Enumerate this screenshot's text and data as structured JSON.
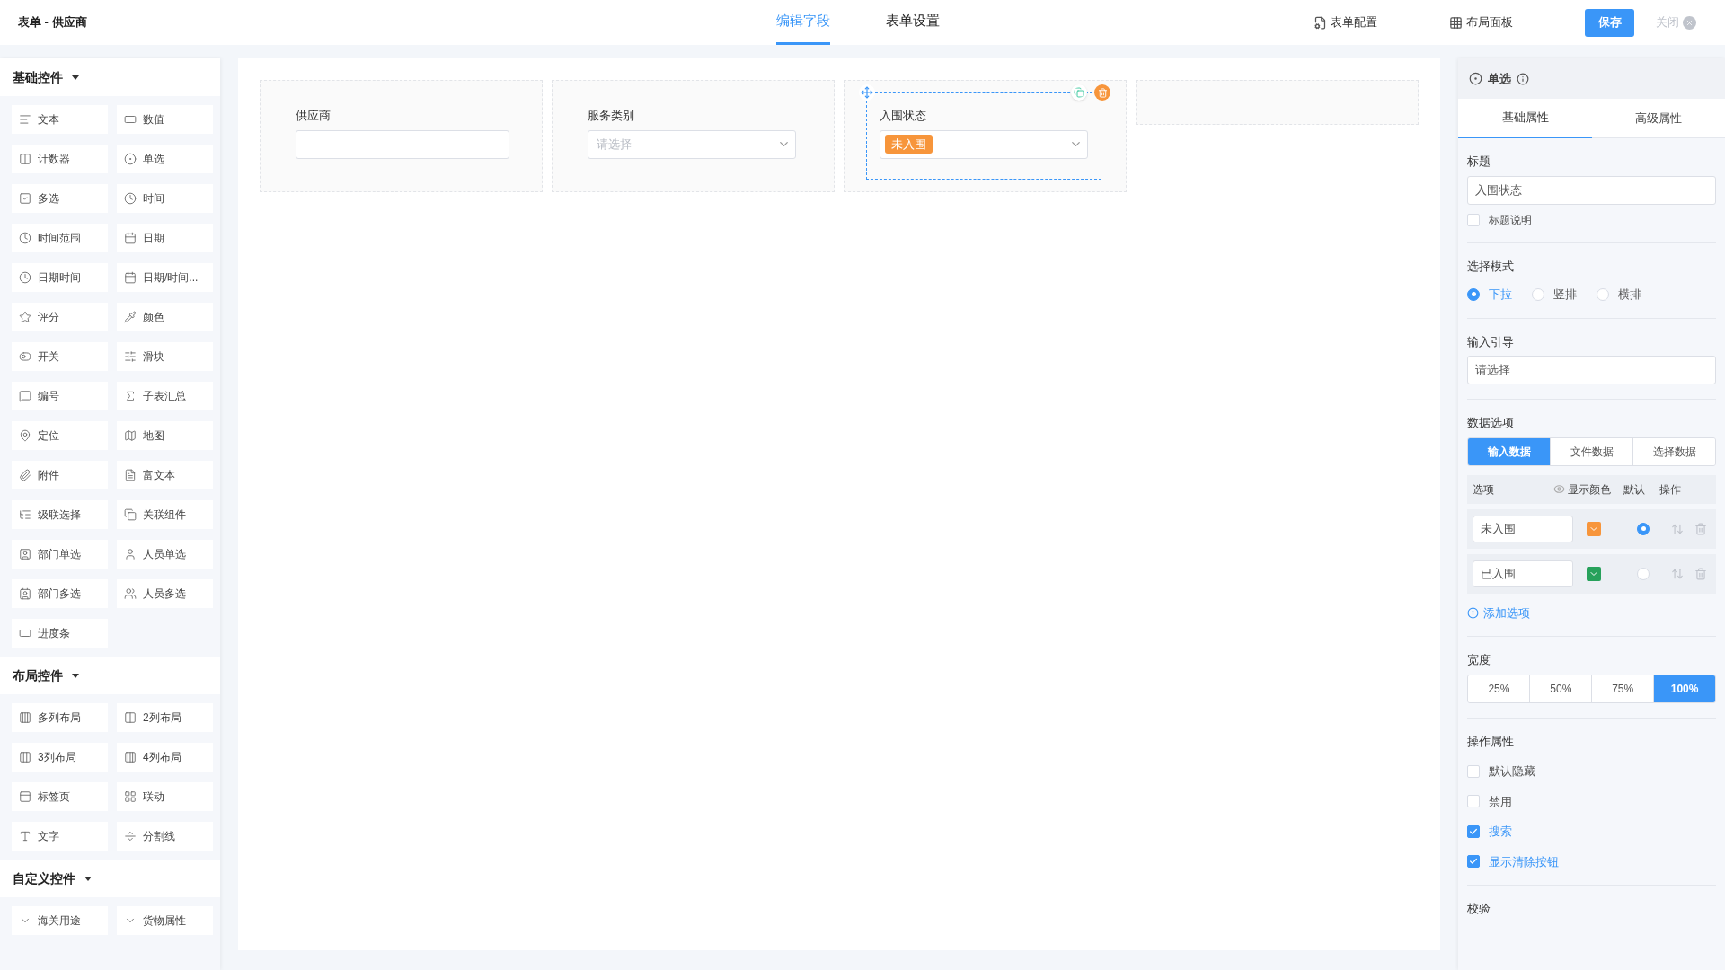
{
  "window": {
    "title": "表单 - 供应商"
  },
  "top_tabs": [
    {
      "label": "编辑字段",
      "selected": true
    },
    {
      "label": "表单设置",
      "selected": false
    }
  ],
  "toolbar": {
    "form_config": "表单配置",
    "layout_panel": "布局面板",
    "save": "保存",
    "close": "关闭"
  },
  "sidebar": {
    "sections": [
      {
        "title": "基础控件",
        "expanded": true,
        "items": [
          "文本",
          "数值",
          "计数器",
          "单选",
          "多选",
          "时间",
          "时间范围",
          "日期",
          "日期时间",
          "日期/时间...",
          "评分",
          "颜色",
          "开关",
          "滑块",
          "编号",
          "子表汇总",
          "定位",
          "地图",
          "附件",
          "富文本",
          "级联选择",
          "关联组件",
          "部门单选",
          "人员单选",
          "部门多选",
          "人员多选",
          "进度条"
        ]
      },
      {
        "title": "布局控件",
        "expanded": true,
        "items": [
          "多列布局",
          "2列布局",
          "3列布局",
          "4列布局",
          "标签页",
          "联动",
          "文字",
          "分割线"
        ]
      },
      {
        "title": "自定义控件",
        "expanded": true,
        "items": [
          "海关用途",
          "货物属性"
        ]
      }
    ]
  },
  "canvas": {
    "fields": [
      {
        "kind": "input",
        "label": "供应商",
        "selected": false
      },
      {
        "kind": "select",
        "label": "服务类别",
        "placeholder": "请选择",
        "selected": false
      },
      {
        "kind": "select",
        "label": "入围状态",
        "value": "未入围",
        "color": "#f7953b",
        "selected": true
      },
      {
        "kind": "empty"
      }
    ]
  },
  "properties": {
    "type": "单选",
    "tabs": [
      {
        "label": "基础属性",
        "selected": true
      },
      {
        "label": "高级属性",
        "selected": false
      }
    ],
    "title_label": "标题",
    "title_value": "入围状态",
    "title_note": {
      "label": "标题说明",
      "checked": false
    },
    "mode_label": "选择模式",
    "modes": [
      {
        "label": "下拉",
        "selected": true
      },
      {
        "label": "竖排",
        "selected": false
      },
      {
        "label": "横排",
        "selected": false
      }
    ],
    "guide_label": "输入引导",
    "guide_value": "请选择",
    "data_label": "数据选项",
    "data_sources": [
      {
        "label": "输入数据",
        "selected": true
      },
      {
        "label": "文件数据",
        "selected": false
      },
      {
        "label": "选择数据",
        "selected": false
      }
    ],
    "options_columns": [
      "选项",
      "显示颜色",
      "默认",
      "操作"
    ],
    "options": [
      {
        "value": "未入围",
        "color": "#f7953b",
        "selected": true
      },
      {
        "value": "已入围",
        "color": "#27a15b",
        "selected": false
      }
    ],
    "add_option": "添加选项",
    "width_label": "宽度",
    "widths": [
      {
        "label": "25%",
        "selected": false
      },
      {
        "label": "50%",
        "selected": false
      },
      {
        "label": "75%",
        "selected": false
      },
      {
        "label": "100%",
        "selected": true
      }
    ],
    "ops_label": "操作属性",
    "ops": [
      {
        "label": "默认隐藏",
        "checked": false
      },
      {
        "label": "禁用",
        "checked": false
      },
      {
        "label": "搜索",
        "checked": true
      },
      {
        "label": "显示清除按钮",
        "checked": true
      }
    ],
    "validation_label": "校验"
  }
}
